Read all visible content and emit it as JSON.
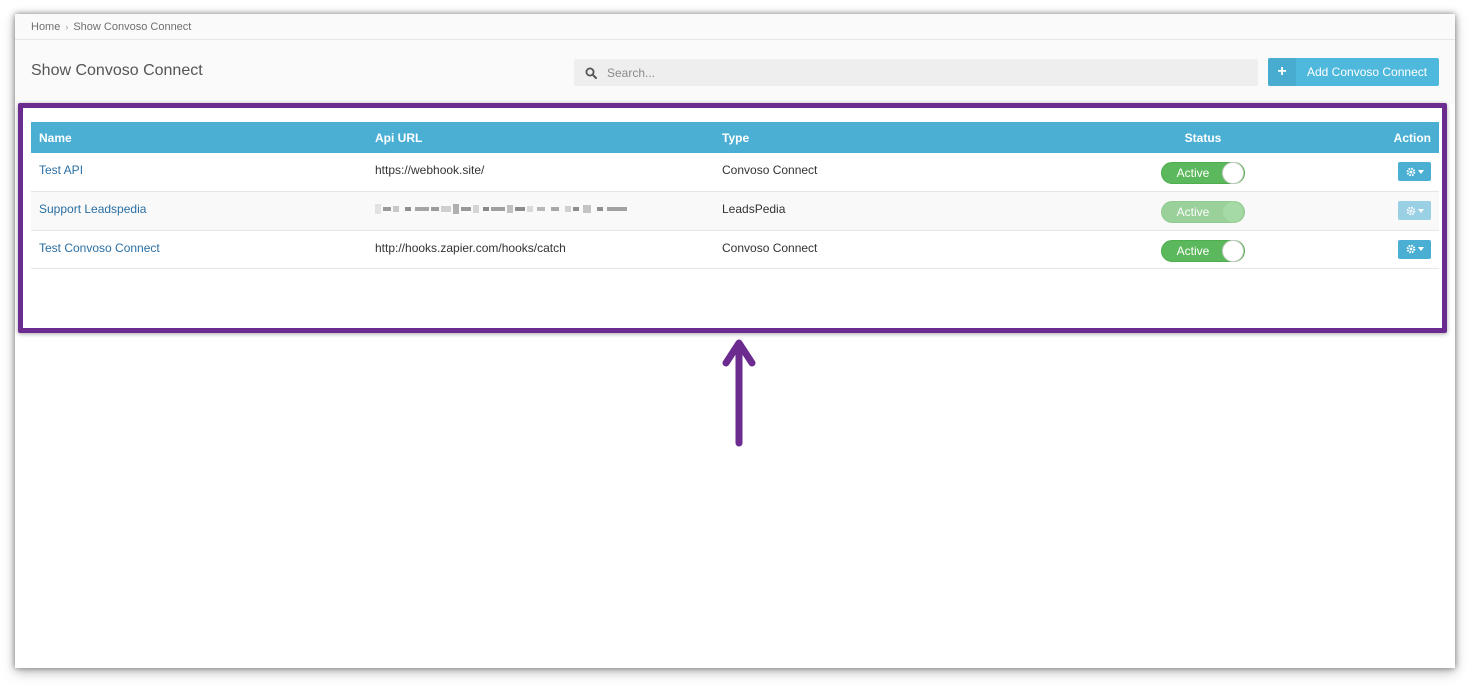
{
  "breadcrumb": {
    "home": "Home",
    "current": "Show Convoso Connect"
  },
  "header": {
    "title": "Show Convoso Connect",
    "search_placeholder": "Search...",
    "add_button_label": "Add Convoso Connect"
  },
  "table": {
    "columns": {
      "name": "Name",
      "api_url": "Api URL",
      "type": "Type",
      "status": "Status",
      "action": "Action"
    },
    "rows": [
      {
        "name": "Test API",
        "api_url": "https://webhook.site/",
        "type": "Convoso Connect",
        "status": "Active"
      },
      {
        "name": "Support Leadspedia",
        "api_url": "",
        "type": "LeadsPedia",
        "status": "Active"
      },
      {
        "name": "Test Convoso Connect",
        "api_url": "http://hooks.zapier.com/hooks/catch",
        "type": "Convoso Connect",
        "status": "Active"
      }
    ]
  },
  "colors": {
    "accent": "#4bafd4",
    "toggle_green": "#5cb85c",
    "highlight": "#6b2b8f",
    "link": "#2a6fa4"
  },
  "icons": {
    "search": "search-icon",
    "plus": "plus-icon",
    "gear": "gear-icon",
    "caret": "caret-down-icon",
    "annotation_arrow": "arrow-up-icon"
  }
}
